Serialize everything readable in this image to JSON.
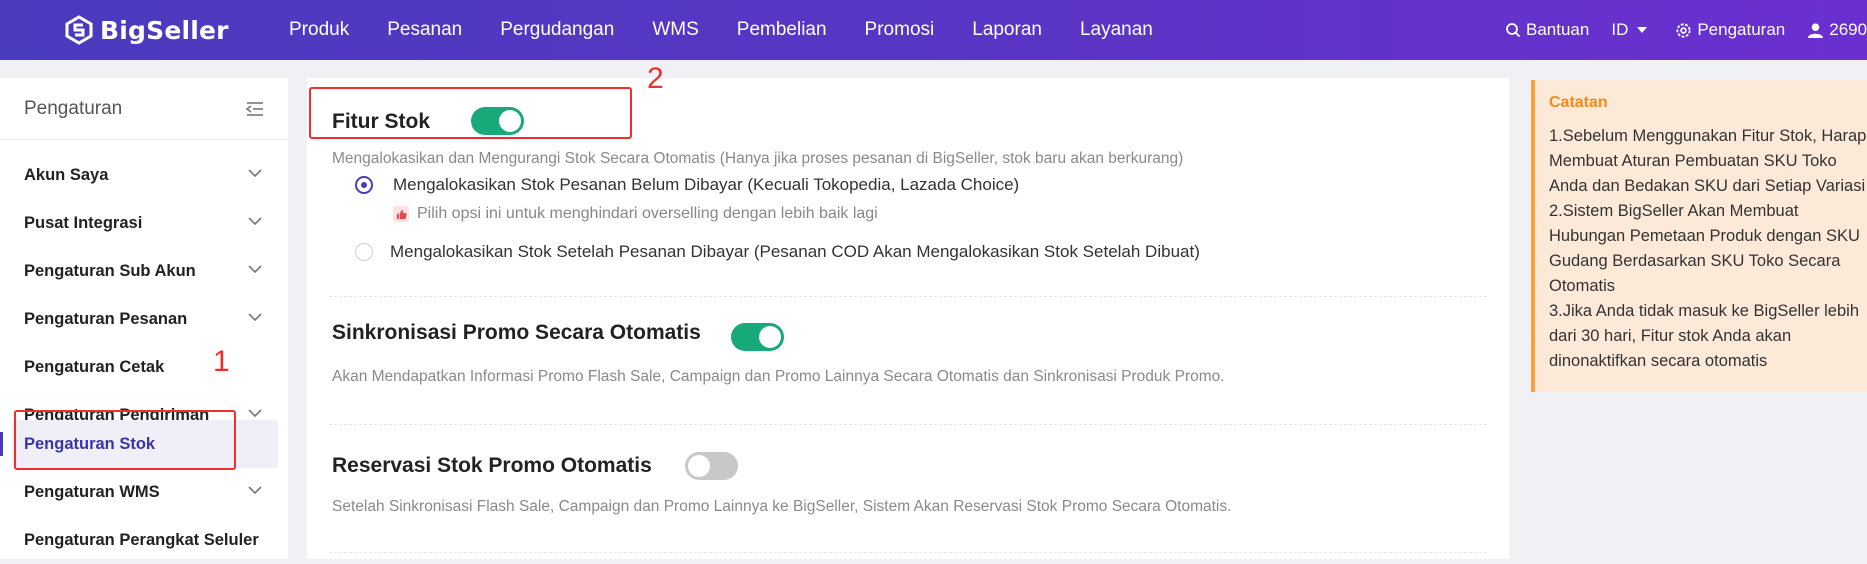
{
  "header": {
    "logo_text": "BigSeller",
    "nav": [
      "Produk",
      "Pesanan",
      "Pergudangan",
      "WMS",
      "Pembelian",
      "Promosi",
      "Laporan",
      "Layanan"
    ],
    "help": "Bantuan",
    "lang": "ID",
    "settings": "Pengaturan",
    "user": "2690"
  },
  "sidebar": {
    "title": "Pengaturan",
    "items": [
      {
        "label": "Akun Saya"
      },
      {
        "label": "Pusat Integrasi"
      },
      {
        "label": "Pengaturan Sub Akun"
      },
      {
        "label": "Pengaturan Pesanan"
      },
      {
        "label": "Pengaturan Cetak"
      },
      {
        "label": "Pengaturan Pengiriman"
      },
      {
        "label": "Pengaturan Stok"
      },
      {
        "label": "Pengaturan WMS"
      },
      {
        "label": "Pengaturan Perangkat Seluler"
      }
    ]
  },
  "annotations": {
    "one": "1",
    "two": "2"
  },
  "main": {
    "stock": {
      "title": "Fitur Stok",
      "enabled": true,
      "desc": "Mengalokasikan dan Mengurangi Stok Secara Otomatis (Hanya jika proses pesanan di BigSeller, stok baru akan berkurang)",
      "option1": "Mengalokasikan Stok Pesanan Belum Dibayar (Kecuali Tokopedia, Lazada Choice)",
      "hint": "Pilih opsi ini untuk menghindari overselling dengan lebih baik lagi",
      "option2": "Mengalokasikan Stok Setelah Pesanan Dibayar (Pesanan COD Akan Mengalokasikan Stok Setelah Dibuat)"
    },
    "promo_sync": {
      "title": "Sinkronisasi Promo Secara Otomatis",
      "enabled": true,
      "desc": "Akan Mendapatkan Informasi Promo Flash Sale, Campaign dan Promo Lainnya Secara Otomatis dan Sinkronisasi Produk Promo."
    },
    "promo_reserve": {
      "title": "Reservasi Stok Promo Otomatis",
      "enabled": false,
      "desc": "Setelah Sinkronisasi Flash Sale, Campaign dan Promo Lainnya ke BigSeller, Sistem Akan Reservasi Stok Promo Secara Otomatis."
    }
  },
  "note": {
    "title": "Catatan",
    "lines": [
      "1.Sebelum Menggunakan Fitur Stok, Harap",
      "Membuat Aturan Pembuatan SKU Toko",
      "Anda dan Bedakan SKU dari Setiap Variasi",
      "2.Sistem BigSeller Akan Membuat",
      "Hubungan Pemetaan Produk dengan SKU",
      "Gudang Berdasarkan SKU Toko Secara",
      "Otomatis",
      "3.Jika Anda tidak masuk ke BigSeller lebih",
      "dari 30 hari, Fitur stok Anda akan",
      "dinonaktifkan secara otomatis"
    ]
  },
  "colors": {
    "primary": "#4a3bbd",
    "toggle_on": "#17a97a",
    "annotation": "#ef2e2e",
    "note_accent": "#f7a143"
  }
}
